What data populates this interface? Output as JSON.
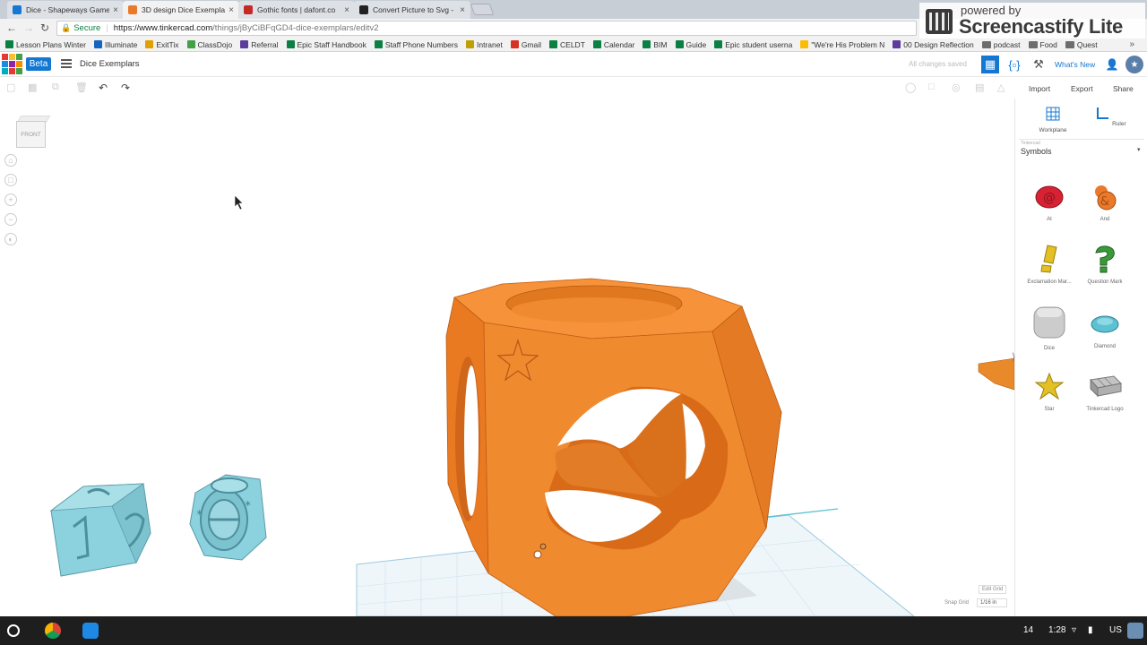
{
  "browser": {
    "tabs": [
      {
        "title": "Dice - Shapeways Game",
        "favicon_color": "#1477d1",
        "active": false
      },
      {
        "title": "3D design Dice Exemplar",
        "favicon_color": "#e9792b",
        "active": true
      },
      {
        "title": "Gothic fonts | dafont.co",
        "favicon_color": "#c62828",
        "active": false
      },
      {
        "title": "Convert Picture to Svg -",
        "favicon_color": "#222222",
        "active": false
      }
    ],
    "close_glyph": "×",
    "secure_label": "Secure",
    "url_host": "https://www.tinkercad.com",
    "url_path": "/things/jByCiBFqGD4-dice-exemplars/editv2",
    "bookmarks": [
      {
        "label": "Lesson Plans Winter",
        "color": "#0b8043",
        "type": "link"
      },
      {
        "label": "Illuminate",
        "color": "#1565c0",
        "type": "link"
      },
      {
        "label": "ExitTix",
        "color": "#e0a000",
        "type": "link"
      },
      {
        "label": "ClassDojo",
        "color": "#43a047",
        "type": "link"
      },
      {
        "label": "Referral",
        "color": "#5c3c9c",
        "type": "link"
      },
      {
        "label": "Epic Staff Handbook",
        "color": "#0b8043",
        "type": "link"
      },
      {
        "label": "Staff Phone Numbers",
        "color": "#0b8043",
        "type": "link"
      },
      {
        "label": "Intranet",
        "color": "#c0a000",
        "type": "link"
      },
      {
        "label": "Gmail",
        "color": "#d93025",
        "type": "link"
      },
      {
        "label": "CELDT",
        "color": "#0b8043",
        "type": "link"
      },
      {
        "label": "Calendar",
        "color": "#0b8043",
        "type": "link"
      },
      {
        "label": "BIM",
        "color": "#0b8043",
        "type": "link"
      },
      {
        "label": "Guide",
        "color": "#0b8043",
        "type": "link"
      },
      {
        "label": "Epic student userna",
        "color": "#0b8043",
        "type": "link"
      },
      {
        "label": "\"We're His Problem N",
        "color": "#fbbc04",
        "type": "link"
      },
      {
        "label": "00 Design Reflection",
        "color": "#5c3c9c",
        "type": "link"
      },
      {
        "label": "podcast",
        "color": "#6d6d6d",
        "type": "folder"
      },
      {
        "label": "Food",
        "color": "#6d6d6d",
        "type": "folder"
      },
      {
        "label": "Quest",
        "color": "#6d6d6d",
        "type": "folder"
      }
    ],
    "overflow_glyph": "»"
  },
  "watermark": {
    "line1": "powered by",
    "line2": "Screencastify Lite"
  },
  "app": {
    "logo_letters": [
      "TIN",
      "KER",
      "CAD"
    ],
    "beta_label": "Beta",
    "document_name": "Dice Exemplars",
    "save_status": "All changes saved",
    "whats_new": "What's New",
    "accent_color": "#1477d1"
  },
  "toolbar": {
    "import_label": "Import",
    "export_label": "Export",
    "share_label": "Share",
    "undo_glyph": "↶",
    "redo_glyph": "↷"
  },
  "viewport": {
    "viewcube_label": "FRONT",
    "controls": [
      "home",
      "fit",
      "zoom-in",
      "zoom-out",
      "perspective"
    ],
    "edit_grid_label": "Edit Grid",
    "snap_grid_label": "Snap Grid",
    "snap_grid_value": "1/16 in"
  },
  "panel": {
    "workplane_label": "Workplane",
    "ruler_label": "Ruler",
    "category_caption": "Tinkercad",
    "category_value": "Symbols",
    "shapes": [
      {
        "label": "At",
        "color": "#d62232"
      },
      {
        "label": "And",
        "color": "#e9792b"
      },
      {
        "label": "Exclamation Mar...",
        "color": "#e3c023"
      },
      {
        "label": "Question Mark",
        "color": "#3a9a3a"
      },
      {
        "label": "Dice",
        "color": "#c8c8c8"
      },
      {
        "label": "Diamond",
        "color": "#5cc1d3"
      },
      {
        "label": "Star",
        "color": "#e3c023"
      },
      {
        "label": "Tinkercad Logo",
        "color": "#a8a8a8"
      }
    ]
  },
  "taskbar": {
    "count": "14",
    "time": "1:28",
    "locale": "US"
  }
}
